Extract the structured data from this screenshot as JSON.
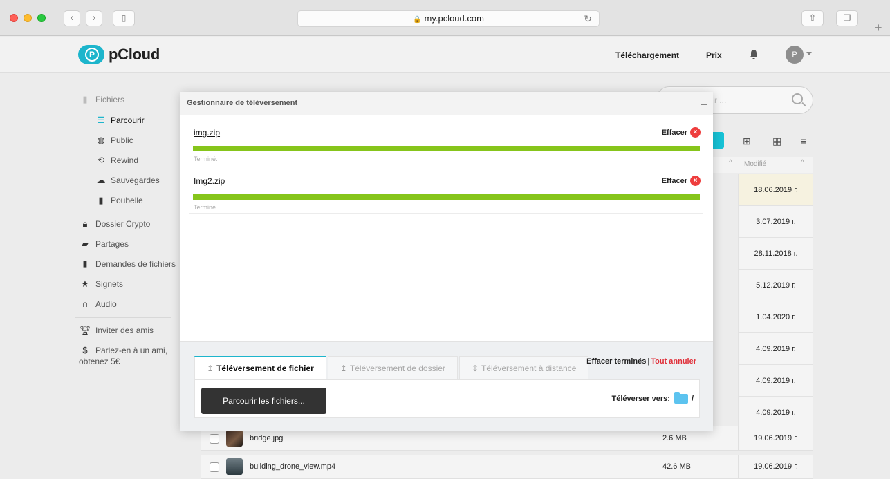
{
  "browser": {
    "url": "my.pcloud.com"
  },
  "header": {
    "logo_text": "pCloud",
    "logo_letter": "P",
    "links": [
      "Téléchargement",
      "Prix"
    ],
    "avatar_letter": "P"
  },
  "sidebar": {
    "items": [
      {
        "label": "Fichiers",
        "icon": "file-icon"
      },
      {
        "label": "Parcourir",
        "icon": "list-icon",
        "active": true
      },
      {
        "label": "Public",
        "icon": "globe-icon"
      },
      {
        "label": "Rewind",
        "icon": "rewind-icon"
      },
      {
        "label": "Sauvegardes",
        "icon": "cloud-backup-icon"
      },
      {
        "label": "Poubelle",
        "icon": "trash-icon"
      },
      {
        "label": "Dossier Crypto",
        "icon": "lock-icon"
      },
      {
        "label": "Partages",
        "icon": "share-folder-icon"
      },
      {
        "label": "Demandes de fichiers",
        "icon": "file-request-icon"
      },
      {
        "label": "Signets",
        "icon": "star-icon"
      },
      {
        "label": "Audio",
        "icon": "headphones-icon"
      },
      {
        "label": "Inviter des amis",
        "icon": "trophy-icon"
      },
      {
        "label": "Parlez-en à un ami,",
        "label2": "obtenez 5€",
        "icon": "dollar-icon"
      }
    ]
  },
  "files": {
    "search_placeholder": "r ...",
    "column_modified": "Modifié",
    "modified_dates": [
      "18.06.2019 г.",
      "3.07.2019 г.",
      "28.11.2018 г.",
      "5.12.2019 г.",
      "1.04.2020 г.",
      "4.09.2019 г.",
      "4.09.2019 г.",
      "4.09.2019 г."
    ],
    "rows": [
      {
        "name": "bridge.jpg",
        "size": "2.6 MB",
        "date": "19.06.2019 г."
      },
      {
        "name": "building_drone_view.mp4",
        "size": "42.6 MB",
        "date": "19.06.2019 г."
      }
    ]
  },
  "upload_manager": {
    "title": "Gestionnaire de téléversement",
    "uploads": [
      {
        "file": "img.zip",
        "clear_label": "Effacer",
        "status": "Terminé.",
        "progress": 1.0
      },
      {
        "file": "Img2.zip",
        "clear_label": "Effacer",
        "status": "Terminé.",
        "progress": 1.0
      }
    ],
    "tabs": [
      "Téléversement de fichier",
      "Téléversement de dossier",
      "Téléversement à distance"
    ],
    "clear_done": "Effacer terminés",
    "separator": "|",
    "cancel_all": "Tout annuler",
    "browse_label": "Parcourir les fichiers...",
    "upload_to_label": "Téléverser vers:",
    "destination": "/"
  },
  "colors": {
    "accent": "#1db5cc",
    "progress": "#86c51b",
    "danger": "#ee3d3d"
  }
}
